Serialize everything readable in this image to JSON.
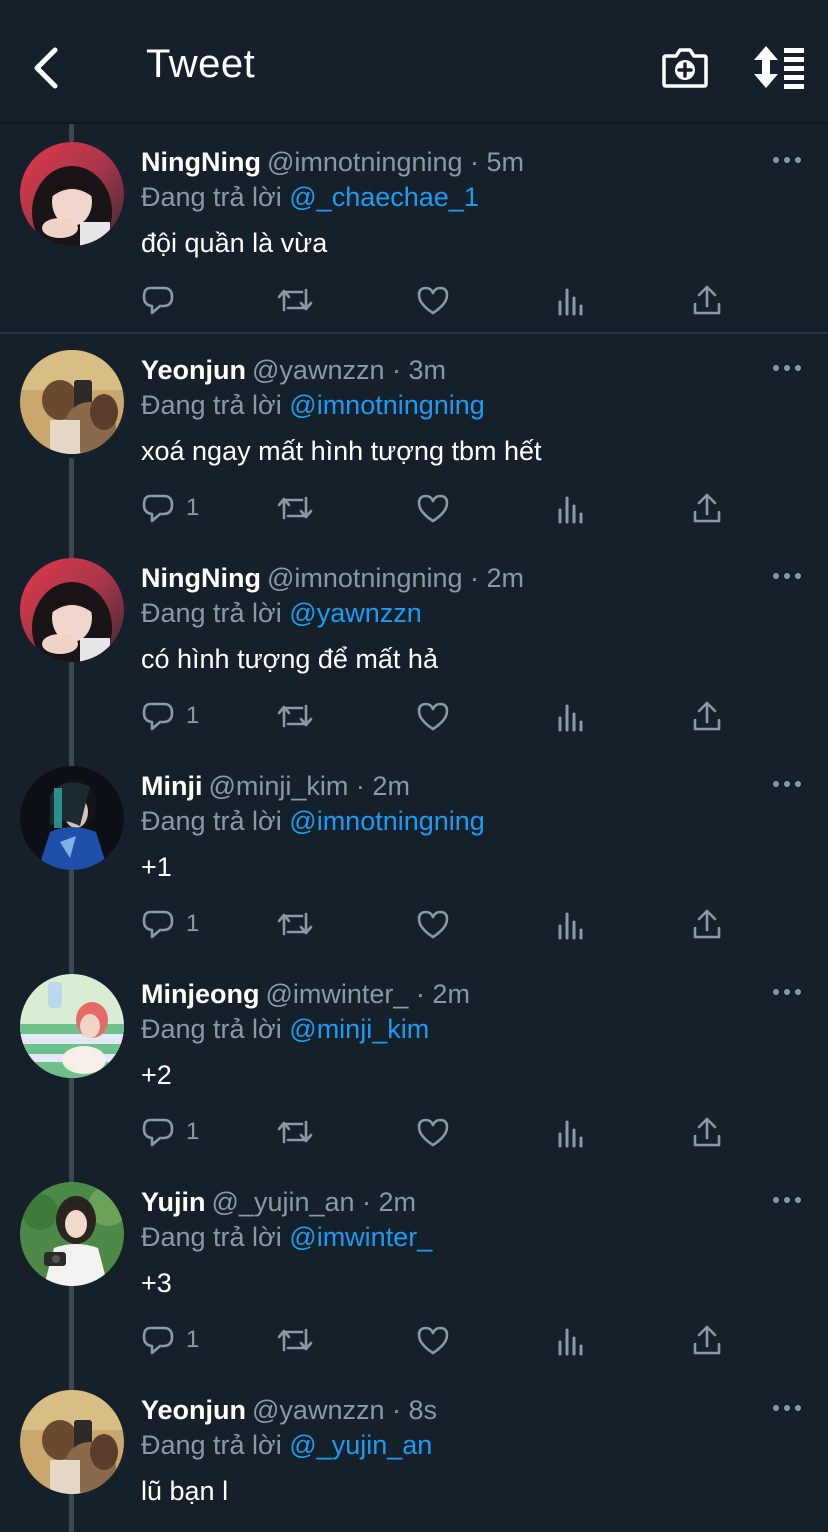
{
  "header": {
    "title": "Tweet",
    "back_icon": "chevron-left-icon",
    "camera_icon": "camera-plus-icon",
    "sort_icon": "sort-list-icon"
  },
  "colors": {
    "background": "#16202b",
    "mention": "#1d9bf0",
    "muted": "#8b98a5"
  },
  "tweets": [
    {
      "name": "NingNing",
      "handle": "@imnotningning",
      "time": "5m",
      "reply_prefix": "Đang trả lời",
      "reply_to": "@_chaechae_1",
      "text": "đội quần là vừa",
      "reply_count": "",
      "avatar": "ningning-avatar"
    },
    {
      "name": "Yeonjun",
      "handle": "@yawnzzn",
      "time": "3m",
      "reply_prefix": "Đang trả lời",
      "reply_to": "@imnotningning",
      "text": "xoá ngay mất hình tượng tbm hết",
      "reply_count": "1",
      "avatar": "yeonjun-avatar"
    },
    {
      "name": "NingNing",
      "handle": "@imnotningning",
      "time": "2m",
      "reply_prefix": "Đang trả lời",
      "reply_to": "@yawnzzn",
      "text": "có hình tượng để mất hả",
      "reply_count": "1",
      "avatar": "ningning-avatar"
    },
    {
      "name": "Minji",
      "handle": "@minji_kim",
      "time": "2m",
      "reply_prefix": "Đang trả lời",
      "reply_to": "@imnotningning",
      "text": "+1",
      "reply_count": "1",
      "avatar": "minji-avatar"
    },
    {
      "name": "Minjeong",
      "handle": "@imwinter_",
      "time": "2m",
      "reply_prefix": "Đang trả lời",
      "reply_to": "@minji_kim",
      "text": "+2",
      "reply_count": "1",
      "avatar": "minjeong-avatar"
    },
    {
      "name": "Yujin",
      "handle": "@_yujin_an",
      "time": "2m",
      "reply_prefix": "Đang trả lời",
      "reply_to": "@imwinter_",
      "text": "+3",
      "reply_count": "1",
      "avatar": "yujin-avatar"
    },
    {
      "name": "Yeonjun",
      "handle": "@yawnzzn",
      "time": "8s",
      "reply_prefix": "Đang trả lời",
      "reply_to": "@_yujin_an",
      "text": "lũ bạn l",
      "reply_count": "",
      "avatar": "yeonjun-avatar"
    }
  ],
  "action_icons": [
    "reply-icon",
    "retweet-icon",
    "like-icon",
    "analytics-icon",
    "share-icon"
  ]
}
